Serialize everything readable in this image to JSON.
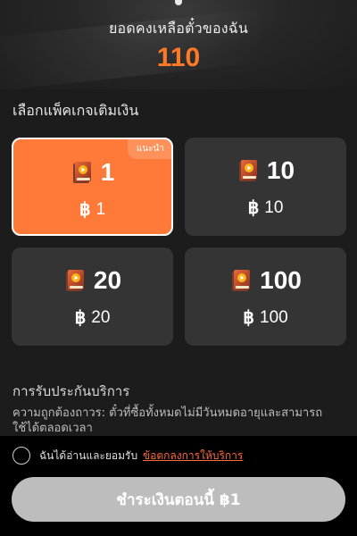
{
  "header": {
    "balance_label": "ยอดคงเหลือตั๋วของฉัน",
    "balance_value": "110"
  },
  "packages": {
    "section_title": "เลือกแพ็คเกจเติมเงิน",
    "items": [
      {
        "count": "1",
        "currency": "฿",
        "price": "1",
        "badge": "แนะนำ",
        "selected": true
      },
      {
        "count": "10",
        "currency": "฿",
        "price": "10",
        "selected": false
      },
      {
        "count": "20",
        "currency": "฿",
        "price": "20",
        "selected": false
      },
      {
        "count": "100",
        "currency": "฿",
        "price": "100",
        "selected": false
      }
    ]
  },
  "guarantee": {
    "title": "การรับประกันบริการ",
    "text": "ความถูกต้องถาวร: ตั๋วที่ซื้อทั้งหมดไม่มีวันหมดอายุและสามารถใช้ได้ตลอดเวลา"
  },
  "footer": {
    "agree_text": "ฉันได้อ่านและยอมรับ",
    "terms_link": "ข้อตกลงการให้บริการ",
    "pay_button": "ชำระเงินตอนนี้ ฿1"
  },
  "colors": {
    "accent": "#ff7a26",
    "selected_card": "#ff7a38",
    "card": "#343434",
    "link": "#ff6a3d",
    "pay_button_disabled": "#bdbdbd"
  },
  "icons": {
    "package_icon": "ticket-book-icon",
    "radio": "radio-unchecked-icon"
  }
}
